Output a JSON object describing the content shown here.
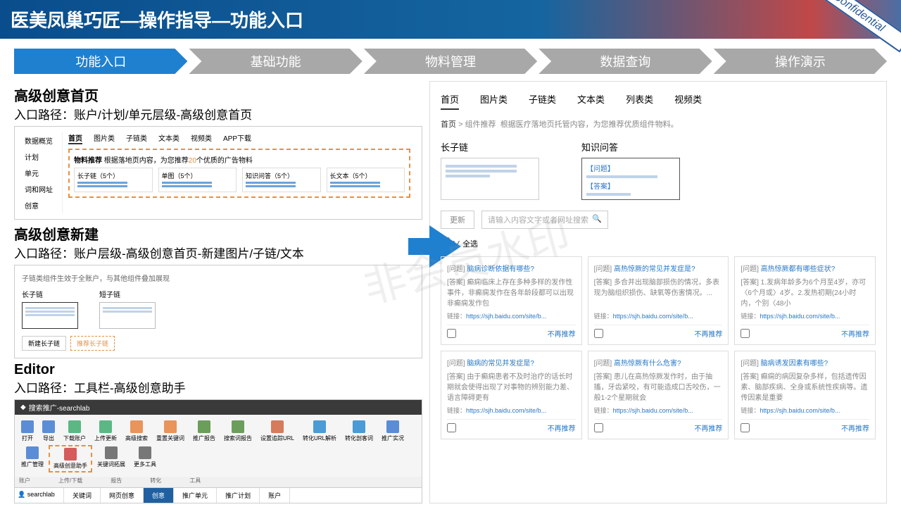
{
  "header": {
    "title": "医美凤巢巧匠—操作指导—功能入口"
  },
  "confidential": "Confidential",
  "watermark": "非会员水印",
  "steps": [
    "功能入口",
    "基础功能",
    "物料管理",
    "数据查询",
    "操作演示"
  ],
  "left": {
    "s1": {
      "title": "高级创意首页",
      "path": "入口路径：账户/计划/单元层级-高级创意首页",
      "side": [
        "数据概览",
        "计划",
        "单元",
        "词和网址",
        "创意"
      ],
      "tabs": [
        "首页",
        "图片类",
        "子链类",
        "文本类",
        "视频类",
        "APP下载"
      ],
      "rec": {
        "pre": "物料推荐",
        "mid": "根据落地页内容，为您推荐",
        "hl": "20",
        "post": "个优质的广告物料"
      },
      "cards": [
        "长子链（5个）",
        "单图（5个）",
        "知识问答（5个）",
        "长文本（5个）"
      ]
    },
    "s2": {
      "title": "高级创意新建",
      "path": "入口路径：账户层级-高级创意首页-新建图片/子链/文本",
      "tip": "子链类组件生效于全账户，与其他组件叠加展现",
      "items": [
        "长子链",
        "短子链"
      ],
      "btns": [
        "新建长子链",
        "推荐长子链"
      ]
    },
    "s3": {
      "title": "Editor",
      "path": "入口路径：工具栏-高级创意助手",
      "wtitle": "搜索推广-searchlab",
      "tools": [
        {
          "l": "打开",
          "c": "#5b8dd6"
        },
        {
          "l": "导出",
          "c": "#5b8dd6"
        },
        {
          "l": "下载账户",
          "c": "#5bb885"
        },
        {
          "l": "上传更新",
          "c": "#5bb885"
        },
        {
          "l": "高级搜索",
          "c": "#e8945b"
        },
        {
          "l": "重置关键词",
          "c": "#e8945b"
        },
        {
          "l": "推广报告",
          "c": "#6b9e5b"
        },
        {
          "l": "搜索词报告",
          "c": "#6b9e5b"
        },
        {
          "l": "设置追踪URL",
          "c": "#d67b5b"
        },
        {
          "l": "转化URL解析",
          "c": "#4a9bd6"
        },
        {
          "l": "转化剖客词",
          "c": "#4a9bd6"
        },
        {
          "l": "推广实况",
          "c": "#5b8dd6"
        },
        {
          "l": "推广管理",
          "c": "#5b8dd6"
        },
        {
          "l": "高级创意助手",
          "c": "#d65b5b",
          "hl": true
        },
        {
          "l": "关键词拓展",
          "c": "#777"
        },
        {
          "l": "更多工具",
          "c": "#777"
        }
      ],
      "groups": [
        "账户",
        "上传/下载",
        "报告",
        "转化",
        "工具"
      ],
      "user": "searchlab",
      "bottabs": [
        "关键词",
        "网页创意",
        "创意",
        "推广单元",
        "推广计划",
        "账户"
      ]
    }
  },
  "right": {
    "tabs": [
      "首页",
      "图片类",
      "子链类",
      "文本类",
      "列表类",
      "视频类"
    ],
    "bc": {
      "home": "首页",
      "sep": ">",
      "cur": "组件推荐",
      "desc": "根据医疗落地页托管内容，为您推荐优质组件物料。"
    },
    "cols": [
      {
        "lbl": "长子链"
      },
      {
        "lbl": "知识问答",
        "qa": [
          "【问题】",
          "【答案】"
        ]
      }
    ],
    "update": "更新",
    "search": "请输入内容文字或者网址搜索",
    "selectall": "全选",
    "cards": [
      {
        "q": "脑病诊断依据有哪些?",
        "a": "癫痫临床上存在多种多样的发作性事件，非癫痫发作在各年龄段都可以出现非癫痫发作包"
      },
      {
        "q": "高热惊厥的常见并发症是?",
        "a": "多合并出现脑部损伤的情况，多表现为脑组织损伤、缺氧等伤害情况。..."
      },
      {
        "q": "高热惊厥都有哪些症状?",
        "a": "1.发病年龄多为6个月至4岁，亦可〈6个月或〉4岁。2.发热初期(24小时内，个别〈48小"
      },
      {
        "q": "脑病的常见并发症是?",
        "a": "由于癫痫患者不及时治疗的话长时期就会使得出现了对事物的辨别能力差、语言障碍更有"
      },
      {
        "q": "高热惊厥有什么危害?",
        "a": "患儿在高热惊厥发作时，由于抽搐，牙齿紧咬，有可能造成口舌咬伤，一般1-2个星期就会"
      },
      {
        "q": "脑病诱发因素有哪些?",
        "a": "癫痫的病因复杂多样，包括遗传因素、脑部疾病、全身或系统性疾病等。遗传因素是重要"
      }
    ],
    "qtag": "[问题]",
    "atag": "[答案]",
    "ltag": "链接：",
    "link": "https://sjh.baidu.com/site/b...",
    "nr": "不再推荐"
  }
}
